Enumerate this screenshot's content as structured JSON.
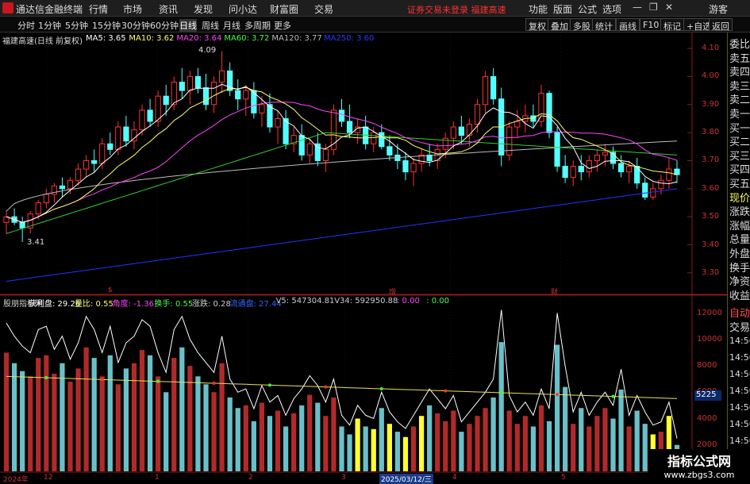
{
  "titlebar": {
    "app": "通达信金融终端",
    "menus": [
      "行情",
      "市场",
      "资讯",
      "发现",
      "问小达",
      "财富圈",
      "交易"
    ],
    "status": "证券交易未登录  福建高速",
    "right": [
      "功能",
      "版面",
      "公式",
      "选项"
    ],
    "guest": "游客"
  },
  "toolbar": {
    "tabs": [
      "分时",
      "1分钟",
      "5分钟",
      "15分钟",
      "30分钟",
      "60分钟",
      "日线",
      "周线",
      "月线",
      "多周期",
      "更多"
    ],
    "active": "日线",
    "right": [
      "复权",
      "叠加",
      "多股",
      "统计",
      "画线",
      "F10",
      "标记",
      "+自选",
      "返回"
    ]
  },
  "main_legend": {
    "name": "福建高速(日线 前复权)",
    "items": [
      {
        "label": "MA5: 3.65",
        "color": "#ffffff"
      },
      {
        "label": "MA10: 3.62",
        "color": "#ffff66"
      },
      {
        "label": "MA20: 3.64",
        "color": "#ff44ff"
      },
      {
        "label": "MA60: 3.72",
        "color": "#44ff44"
      },
      {
        "label": "MA120: 3.77",
        "color": "#bbbbbb"
      },
      {
        "label": "MA250: 3.60",
        "color": "#3333ff"
      }
    ]
  },
  "price_axis": [
    "4.10",
    "4.00",
    "3.90",
    "3.80",
    "3.70",
    "3.60",
    "3.50",
    "3.40",
    "3.30"
  ],
  "annotations": {
    "high": "4.09",
    "low": "3.41"
  },
  "event_markers": [
    "$",
    "增",
    "财"
  ],
  "indicator_legend": [
    {
      "label": "股朋指标网",
      "color": "#cccccc"
    },
    {
      "label": "获利盘: 29.26",
      "color": "#ffffff"
    },
    {
      "label": "量比: 0.55",
      "color": "#ffff66"
    },
    {
      "label": "角度: -1.36",
      "color": "#ff44ff"
    },
    {
      "label": "换手: 0.55",
      "color": "#44ff44"
    },
    {
      "label": "涨跌: 0.28",
      "color": "#cccccc"
    },
    {
      "label": "流通盘: 27.44",
      "color": "#3366ff"
    },
    {
      "label": "V5: 547304.81",
      "color": "#cccccc"
    },
    {
      "label": "V34: 592950.88",
      "color": "#cccccc"
    },
    {
      "label": ": 0.00",
      "color": "#ff44ff"
    },
    {
      "label": ": 0.00",
      "color": "#44ff44"
    }
  ],
  "volume_axis": [
    "12000",
    "10000",
    "8000",
    "6000",
    "4000",
    "2000"
  ],
  "volume_highlight": "5225",
  "date_axis": [
    {
      "label": "2024年",
      "hl": false
    },
    {
      "label": "12",
      "hl": false
    },
    {
      "label": "1",
      "hl": false
    },
    {
      "label": "2",
      "hl": false
    },
    {
      "label": "3",
      "hl": false
    },
    {
      "label": "2025/03/12/三",
      "hl": true
    },
    {
      "label": "4",
      "hl": false
    },
    {
      "label": "5",
      "hl": false
    }
  ],
  "right_panel": {
    "top": [
      "委比",
      "卖五",
      "卖四",
      "卖三",
      "卖二",
      "卖一",
      "买一",
      "买二",
      "买三",
      "买四",
      "买五",
      "现价",
      "涨跌",
      "涨幅",
      "总量",
      "外盘",
      "换手",
      "净资",
      "收益"
    ],
    "bottom_head": [
      "自动",
      "交易"
    ],
    "times": [
      "14:56",
      "14:56",
      "14:56",
      "14:56",
      "14:56",
      "14:56",
      "14:56",
      "14:56"
    ]
  },
  "chart_data": {
    "type": "candlestick",
    "title": "福建高速(日线 前复权)",
    "ylim": [
      3.26,
      4.12
    ],
    "ohlc": [
      [
        3.48,
        3.52,
        3.44,
        3.5
      ],
      [
        3.5,
        3.53,
        3.47,
        3.48
      ],
      [
        3.48,
        3.5,
        3.41,
        3.46
      ],
      [
        3.46,
        3.52,
        3.44,
        3.51
      ],
      [
        3.51,
        3.56,
        3.49,
        3.55
      ],
      [
        3.55,
        3.6,
        3.53,
        3.58
      ],
      [
        3.58,
        3.62,
        3.55,
        3.61
      ],
      [
        3.61,
        3.64,
        3.57,
        3.6
      ],
      [
        3.6,
        3.64,
        3.58,
        3.63
      ],
      [
        3.63,
        3.69,
        3.61,
        3.67
      ],
      [
        3.67,
        3.72,
        3.64,
        3.7
      ],
      [
        3.7,
        3.74,
        3.66,
        3.69
      ],
      [
        3.69,
        3.78,
        3.67,
        3.76
      ],
      [
        3.76,
        3.8,
        3.72,
        3.74
      ],
      [
        3.74,
        3.84,
        3.72,
        3.82
      ],
      [
        3.82,
        3.86,
        3.75,
        3.77
      ],
      [
        3.77,
        3.84,
        3.74,
        3.81
      ],
      [
        3.81,
        3.9,
        3.79,
        3.88
      ],
      [
        3.88,
        3.92,
        3.82,
        3.84
      ],
      [
        3.84,
        3.95,
        3.82,
        3.93
      ],
      [
        3.93,
        3.97,
        3.86,
        3.9
      ],
      [
        3.9,
        4.0,
        3.88,
        3.98
      ],
      [
        3.98,
        4.03,
        3.92,
        3.95
      ],
      [
        3.95,
        4.02,
        3.9,
        4.0
      ],
      [
        4.0,
        4.03,
        3.94,
        3.96
      ],
      [
        3.96,
        4.01,
        3.88,
        3.9
      ],
      [
        3.9,
        4.0,
        3.87,
        3.98
      ],
      [
        3.98,
        4.09,
        3.94,
        4.02
      ],
      [
        4.02,
        4.05,
        3.93,
        3.95
      ],
      [
        3.95,
        3.99,
        3.88,
        3.92
      ],
      [
        3.92,
        3.97,
        3.86,
        3.95
      ],
      [
        3.95,
        3.98,
        3.85,
        3.87
      ],
      [
        3.87,
        3.93,
        3.82,
        3.9
      ],
      [
        3.9,
        3.94,
        3.8,
        3.82
      ],
      [
        3.82,
        3.88,
        3.76,
        3.85
      ],
      [
        3.85,
        3.88,
        3.74,
        3.76
      ],
      [
        3.76,
        3.82,
        3.73,
        3.79
      ],
      [
        3.79,
        3.83,
        3.7,
        3.72
      ],
      [
        3.72,
        3.78,
        3.69,
        3.76
      ],
      [
        3.76,
        3.8,
        3.68,
        3.7
      ],
      [
        3.7,
        3.76,
        3.66,
        3.74
      ],
      [
        3.74,
        3.9,
        3.72,
        3.88
      ],
      [
        3.88,
        3.92,
        3.82,
        3.84
      ],
      [
        3.84,
        3.9,
        3.78,
        3.8
      ],
      [
        3.8,
        3.85,
        3.76,
        3.82
      ],
      [
        3.82,
        3.86,
        3.74,
        3.76
      ],
      [
        3.76,
        3.82,
        3.73,
        3.8
      ],
      [
        3.8,
        3.83,
        3.74,
        3.75
      ],
      [
        3.75,
        3.79,
        3.7,
        3.72
      ],
      [
        3.72,
        3.76,
        3.67,
        3.7
      ],
      [
        3.7,
        3.73,
        3.63,
        3.66
      ],
      [
        3.66,
        3.71,
        3.61,
        3.69
      ],
      [
        3.69,
        3.74,
        3.66,
        3.72
      ],
      [
        3.72,
        3.76,
        3.68,
        3.7
      ],
      [
        3.7,
        3.76,
        3.67,
        3.74
      ],
      [
        3.74,
        3.8,
        3.71,
        3.78
      ],
      [
        3.78,
        3.84,
        3.74,
        3.82
      ],
      [
        3.82,
        3.86,
        3.76,
        3.79
      ],
      [
        3.79,
        3.85,
        3.75,
        3.83
      ],
      [
        3.83,
        3.92,
        3.8,
        3.9
      ],
      [
        3.9,
        4.02,
        3.87,
        4.0
      ],
      [
        4.0,
        4.03,
        3.9,
        3.92
      ],
      [
        3.92,
        3.96,
        3.68,
        3.72
      ],
      [
        3.72,
        3.84,
        3.7,
        3.82
      ],
      [
        3.82,
        3.88,
        3.78,
        3.84
      ],
      [
        3.84,
        3.9,
        3.8,
        3.86
      ],
      [
        3.86,
        3.9,
        3.82,
        3.84
      ],
      [
        3.84,
        3.97,
        3.82,
        3.94
      ],
      [
        3.94,
        3.95,
        3.78,
        3.8
      ],
      [
        3.8,
        3.82,
        3.66,
        3.68
      ],
      [
        3.68,
        3.72,
        3.62,
        3.64
      ],
      [
        3.64,
        3.7,
        3.61,
        3.68
      ],
      [
        3.68,
        3.72,
        3.63,
        3.66
      ],
      [
        3.66,
        3.72,
        3.64,
        3.7
      ],
      [
        3.7,
        3.74,
        3.66,
        3.72
      ],
      [
        3.72,
        3.76,
        3.68,
        3.73
      ],
      [
        3.73,
        3.75,
        3.67,
        3.69
      ],
      [
        3.69,
        3.72,
        3.64,
        3.66
      ],
      [
        3.66,
        3.7,
        3.62,
        3.68
      ],
      [
        3.68,
        3.71,
        3.6,
        3.62
      ],
      [
        3.62,
        3.64,
        3.56,
        3.57
      ],
      [
        3.57,
        3.62,
        3.56,
        3.6
      ],
      [
        3.6,
        3.65,
        3.58,
        3.63
      ],
      [
        3.63,
        3.71,
        3.6,
        3.67
      ],
      [
        3.67,
        3.7,
        3.62,
        3.65
      ]
    ],
    "volume": [
      9000,
      8200,
      7600,
      7200,
      8600,
      8800,
      7400,
      8200,
      6800,
      7800,
      9400,
      8600,
      7200,
      8800,
      6600,
      7800,
      8200,
      9200,
      8800,
      7200,
      6000,
      8600,
      9400,
      8000,
      7200,
      6600,
      6000,
      8200,
      5600,
      4800,
      5000,
      3800,
      5200,
      4200,
      4600,
      3400,
      4400,
      5000,
      5800,
      5200,
      4200,
      5600,
      3400,
      2800,
      4000,
      3400,
      3200,
      4800,
      3600,
      3000,
      2600,
      3400,
      4200,
      5000,
      4400,
      3800,
      4600,
      3000,
      3600,
      4200,
      4800,
      5600,
      9800,
      4600,
      3600,
      4200,
      3400,
      5000,
      3800,
      9600,
      6400,
      3600,
      4800,
      3400,
      4200,
      4800,
      4000,
      6200,
      3400,
      4600,
      3600,
      2800,
      3000,
      4200,
      2000
    ]
  }
}
